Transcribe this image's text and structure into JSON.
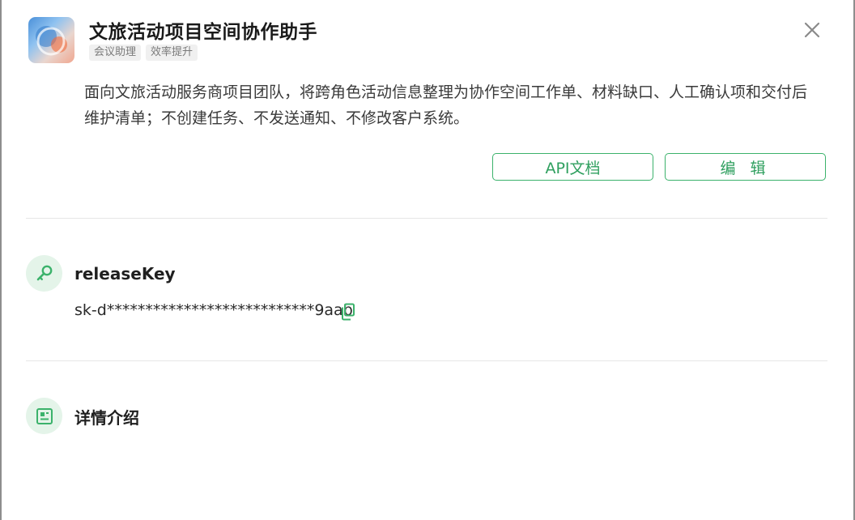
{
  "app": {
    "title": "文旅活动项目空间协作助手",
    "tags": [
      "会议助理",
      "效率提升"
    ],
    "description": "面向文旅活动服务商项目团队，将跨角色活动信息整理为协作空间工作单、材料缺口、人工确认项和交付后维护清单；不创建任务、不发送通知、不修改客户系统。"
  },
  "actions": {
    "api_docs_label": "API文档",
    "edit_label": "编 辑"
  },
  "release_key": {
    "label": "releaseKey",
    "value": "sk-d***************************9aab"
  },
  "details": {
    "label": "详情介绍"
  },
  "icons": {
    "close": "close-icon",
    "key": "key-icon",
    "copy": "copy-icon",
    "document": "document-icon"
  },
  "colors": {
    "accent": "#3bb26b",
    "accent_bg": "#e4f4e9"
  }
}
